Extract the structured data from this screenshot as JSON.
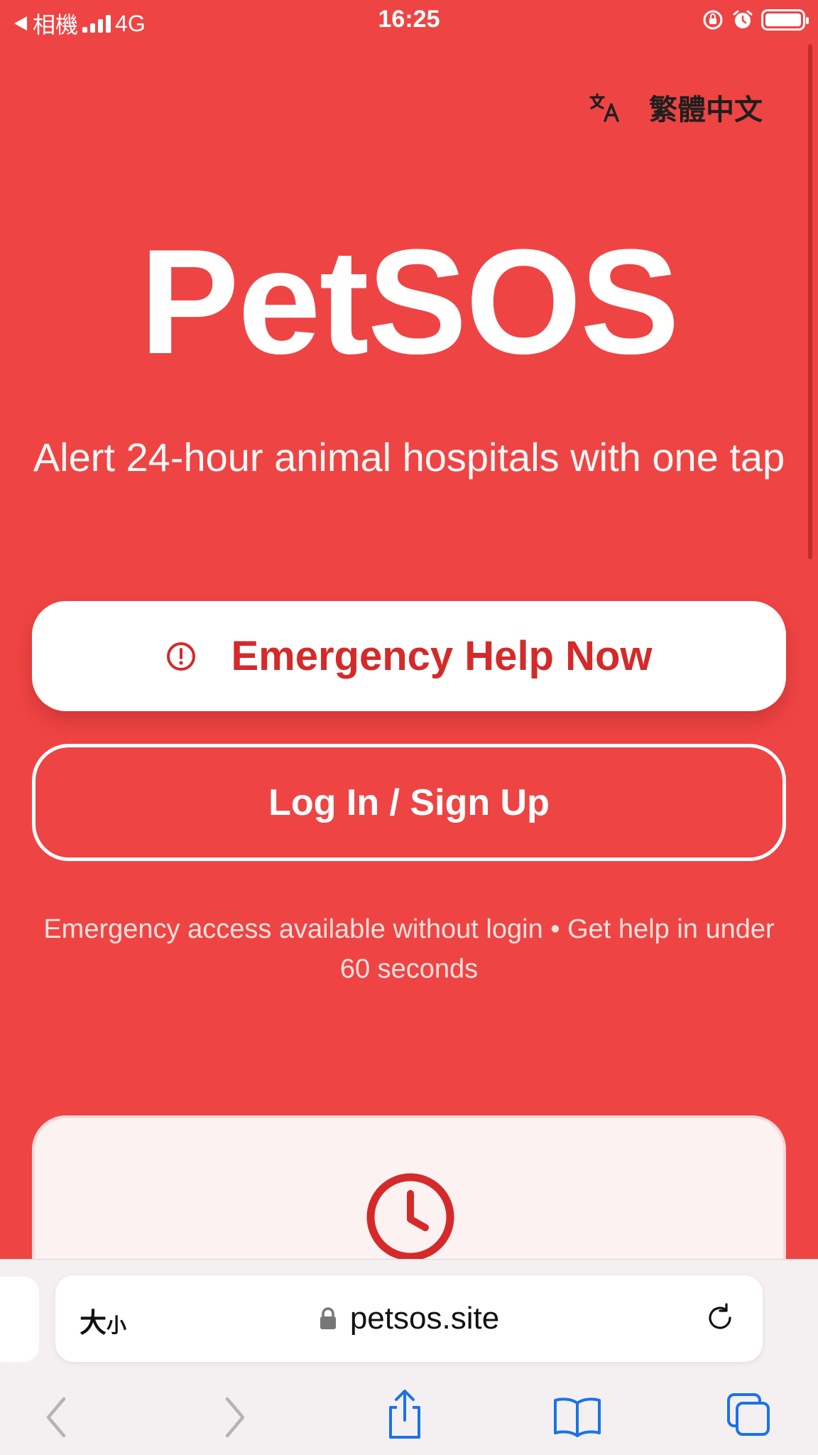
{
  "status_bar": {
    "back_app": "相機",
    "network": "4G",
    "time": "16:25"
  },
  "language": {
    "label": "繁體中文"
  },
  "hero": {
    "title": "PetSOS",
    "tagline": "Alert 24-hour animal hospitals with one tap"
  },
  "actions": {
    "emergency_label": "Emergency Help Now",
    "login_label": "Log In / Sign Up"
  },
  "note": "Emergency access available without login • Get help in under 60 seconds",
  "browser": {
    "text_size_big": "大",
    "text_size_small": "小",
    "url": "petsos.site"
  },
  "colors": {
    "background": "#ef4444",
    "accent_text": "#d42a2a",
    "card_bg": "#fdf2f2",
    "ios_blue": "#1a73e8"
  },
  "icons": {
    "translate": "translate-icon",
    "alert": "alert-circle-icon",
    "clock": "clock-icon",
    "lock": "lock-icon",
    "reload": "reload-icon",
    "back": "chevron-left-icon",
    "forward": "chevron-right-icon",
    "share": "share-icon",
    "bookmarks": "book-icon",
    "tabs": "tabs-icon"
  }
}
